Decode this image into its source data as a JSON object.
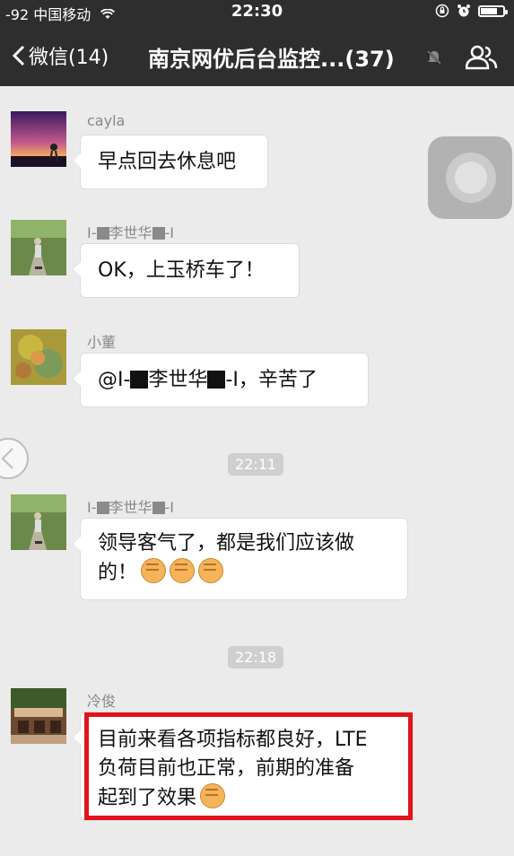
{
  "status": {
    "signal": "-92",
    "carrier": "中国移动",
    "time": "22:30"
  },
  "nav": {
    "back_label": "微信(14)",
    "title": "南京网优后台监控...(37)"
  },
  "messages": [
    {
      "name": "cayla",
      "text": "早点回去休息吧"
    },
    {
      "name_pre": "I-",
      "name_mid": "李世华",
      "name_post": "-I",
      "text": "OK，上玉桥车了！"
    },
    {
      "name": "小董",
      "text_pre": "@I-",
      "text_mid": "李世华",
      "text_post": "-I，辛苦了"
    },
    {
      "name_pre": "I-",
      "name_mid": "李世华",
      "name_post": "-I",
      "text_line1": "领导客气了，都是我们应该做",
      "text_line2": "的！"
    },
    {
      "name": "冷俊",
      "text_line1": "目前来看各项指标都良好，LTE",
      "text_line2": "负荷目前也正常，前期的准备",
      "text_line3": "起到了效果"
    }
  ],
  "times": [
    "22:11",
    "22:18"
  ],
  "colors": {
    "topbar": "#2e2e2e",
    "background": "#ebebeb",
    "highlight": "#e0141c"
  }
}
